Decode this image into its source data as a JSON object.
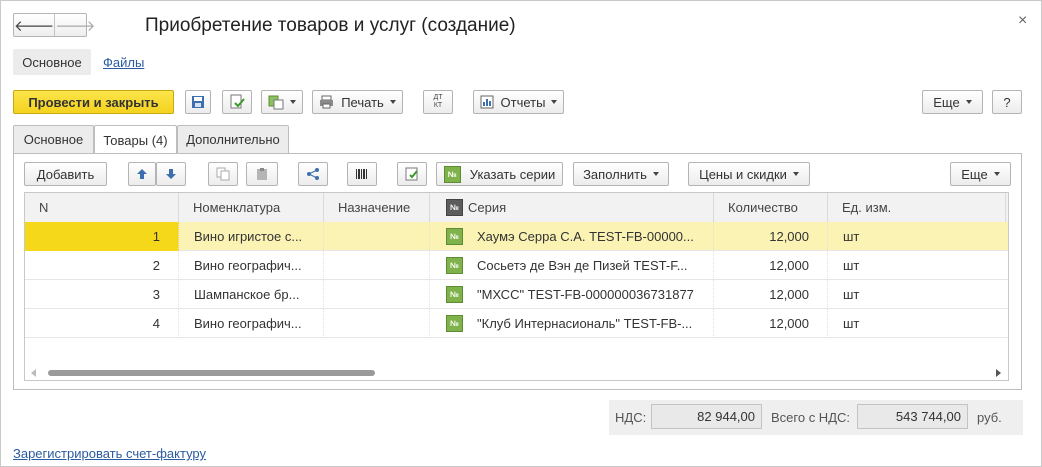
{
  "window": {
    "title": "Приобретение товаров и услуг (создание)",
    "close_glyph": "×",
    "nav_back": "🡐",
    "nav_forward": "🡒"
  },
  "sections": [
    "Основное",
    "Файлы"
  ],
  "toolbar": {
    "post_close": "Провести и закрыть",
    "print": "Печать",
    "reports": "Отчеты",
    "more": "Еще",
    "help": "?"
  },
  "tabs": [
    "Основное",
    "Товары (4)",
    "Дополнительно"
  ],
  "table_toolbar": {
    "add": "Добавить",
    "specify_series": "Указать серии",
    "fill": "Заполнить",
    "prices": "Цены и скидки",
    "more": "Еще"
  },
  "table": {
    "columns": [
      "N",
      "Номенклатура",
      "Назначение",
      "Серия",
      "Количество",
      "Ед. изм."
    ],
    "rows": [
      {
        "n": "1",
        "item": "Вино игристое с...",
        "purpose": "",
        "series": "Хаумэ Серра С.А. TEST-FB-00000...",
        "qty": "12,000",
        "unit": "шт",
        "selected": true
      },
      {
        "n": "2",
        "item": "Вино географич...",
        "purpose": "",
        "series": "Сосьетэ де Вэн де Пизей TEST-F...",
        "qty": "12,000",
        "unit": "шт",
        "selected": false
      },
      {
        "n": "3",
        "item": "Шампанское бр...",
        "purpose": "",
        "series": "\"МХСС\" TEST-FB-000000036731877",
        "qty": "12,000",
        "unit": "шт",
        "selected": false
      },
      {
        "n": "4",
        "item": "Вино географич...",
        "purpose": "",
        "series": "\"Клуб Интернасиональ\" TEST-FB-...",
        "qty": "12,000",
        "unit": "шт",
        "selected": false
      }
    ],
    "series_icon": "№"
  },
  "totals": {
    "vat_label": "НДС:",
    "vat_value": "82 944,00",
    "total_label": "Всего с НДС:",
    "total_value": "543 744,00",
    "currency": "руб."
  },
  "footer": {
    "register_invoice": "Зарегистрировать счет-фактуру"
  },
  "colors": {
    "accent_yellow": "#f4d21e",
    "selected_row": "#fbf3b4",
    "link": "#2a5aa0",
    "series_icon": "#7fb24a"
  }
}
